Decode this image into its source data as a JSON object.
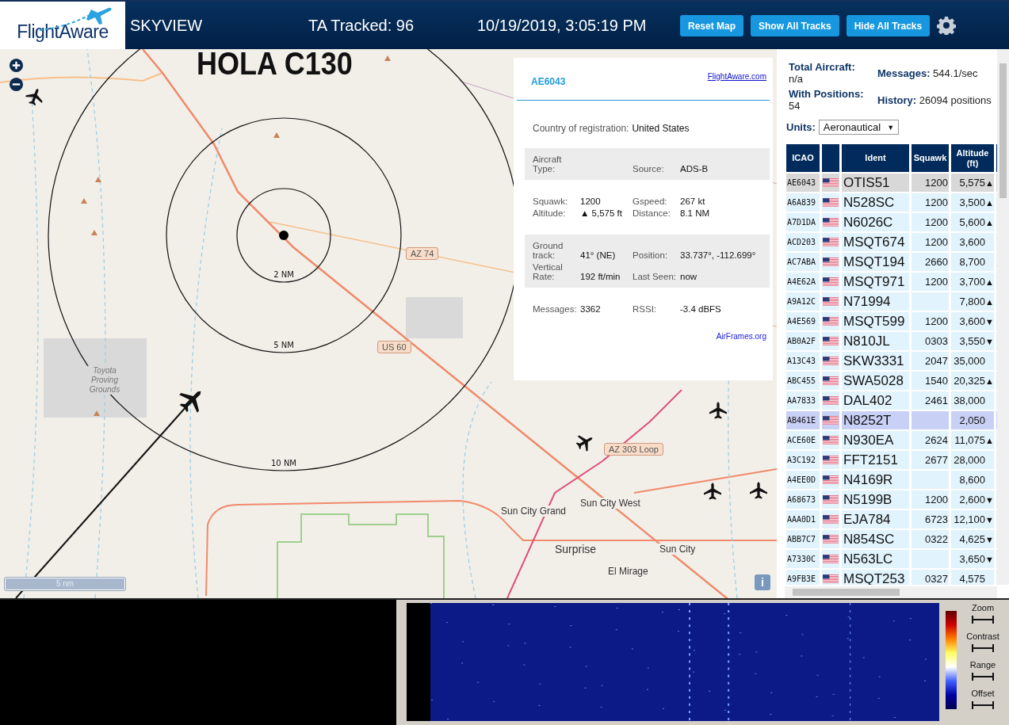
{
  "header": {
    "logo": "FlightAware",
    "title": "SKYVIEW",
    "tracked": "TA Tracked: 96",
    "datetime": "10/19/2019, 3:05:19 PM",
    "buttons": [
      "Reset Map",
      "Show All Tracks",
      "Hide All Tracks"
    ]
  },
  "map": {
    "annotation": "HOLA C130",
    "rings": [
      "2 NM",
      "5 NM",
      "10 NM"
    ],
    "scale": "5 nm",
    "info_button": "i",
    "labels": [
      {
        "text": "AZ 74",
        "kind": "shield"
      },
      {
        "text": "US 60",
        "kind": "shield"
      },
      {
        "text": "AZ 303 Loop",
        "kind": "shield"
      },
      {
        "text": "Toyota Proving Grounds",
        "kind": "area"
      },
      {
        "text": "Sun City Grand",
        "kind": "town"
      },
      {
        "text": "Sun City West",
        "kind": "town"
      },
      {
        "text": "Surprise",
        "kind": "city"
      },
      {
        "text": "Sun City",
        "kind": "town"
      },
      {
        "text": "El Mirage",
        "kind": "town"
      }
    ]
  },
  "popup": {
    "icao": "AE6043",
    "link": "FlightAware.com",
    "sections": [
      {
        "kind": "wide",
        "items": [
          {
            "label": "Country of registration:",
            "value": "United States"
          }
        ]
      },
      {
        "kind": "band",
        "items": [
          {
            "label": "Aircraft Type:",
            "value": ""
          },
          {
            "label": "Source:",
            "value": "ADS-B"
          }
        ]
      },
      {
        "kind": "grid",
        "items": [
          {
            "label": "Squawk:",
            "value": "1200"
          },
          {
            "label": "Gspeed:",
            "value": "267 kt"
          },
          {
            "label": "Altitude:",
            "value": "▲ 5,575 ft"
          },
          {
            "label": "Distance:",
            "value": "8.1 NM"
          }
        ]
      },
      {
        "kind": "band",
        "items": [
          {
            "label": "Ground track:",
            "value": "41° (NE)"
          },
          {
            "label": "Position:",
            "value": "33.737°, -112.699°"
          },
          {
            "label": "Vertical Rate:",
            "value": "192 ft/min"
          },
          {
            "label": "Last Seen:",
            "value": "now"
          }
        ]
      },
      {
        "kind": "grid",
        "items": [
          {
            "label": "Messages:",
            "value": "3362"
          },
          {
            "label": "RSSI:",
            "value": "-3.4 dBFS"
          }
        ]
      }
    ],
    "footer_link": "AirFrames.org"
  },
  "stats": [
    {
      "label": "Total Aircraft:",
      "value": "n/a"
    },
    {
      "label": "Messages:",
      "value": "544.1/sec"
    },
    {
      "label": "With Positions:",
      "value": "54"
    },
    {
      "label": "History:",
      "value": "26094 positions"
    }
  ],
  "units": {
    "label": "Units:",
    "value": "Aeronautical",
    "caret": "▼"
  },
  "table": {
    "columns": [
      "ICAO",
      "",
      "Ident",
      "Squawk",
      "Altitude (ft)"
    ],
    "rows": [
      {
        "icao": "AE6043",
        "ident": "OTIS51",
        "squawk": "1200",
        "altitude": "5,575",
        "trend": "▲",
        "selected": true,
        "highlighted": false
      },
      {
        "icao": "A6A839",
        "ident": "N528SC",
        "squawk": "1200",
        "altitude": "3,500",
        "trend": "▲",
        "selected": false,
        "highlighted": false
      },
      {
        "icao": "A7D1DA",
        "ident": "N6026C",
        "squawk": "1200",
        "altitude": "5,600",
        "trend": "▲",
        "selected": false,
        "highlighted": false
      },
      {
        "icao": "ACD203",
        "ident": "MSQT674",
        "squawk": "1200",
        "altitude": "3,600",
        "trend": "",
        "selected": false,
        "highlighted": false
      },
      {
        "icao": "AC7ABA",
        "ident": "MSQT194",
        "squawk": "2660",
        "altitude": "8,700",
        "trend": "",
        "selected": false,
        "highlighted": false
      },
      {
        "icao": "A4E62A",
        "ident": "MSQT971",
        "squawk": "1200",
        "altitude": "3,700",
        "trend": "▲",
        "selected": false,
        "highlighted": false
      },
      {
        "icao": "A9A12C",
        "ident": "N71994",
        "squawk": "",
        "altitude": "7,800",
        "trend": "▲",
        "selected": false,
        "highlighted": false
      },
      {
        "icao": "A4E569",
        "ident": "MSQT599",
        "squawk": "1200",
        "altitude": "3,600",
        "trend": "▼",
        "selected": false,
        "highlighted": false
      },
      {
        "icao": "AB0A2F",
        "ident": "N810JL",
        "squawk": "0303",
        "altitude": "3,550",
        "trend": "▼",
        "selected": false,
        "highlighted": false
      },
      {
        "icao": "A13C43",
        "ident": "SKW3331",
        "squawk": "2047",
        "altitude": "35,000",
        "trend": "",
        "selected": false,
        "highlighted": false
      },
      {
        "icao": "ABC455",
        "ident": "SWA5028",
        "squawk": "1540",
        "altitude": "20,325",
        "trend": "▲",
        "selected": false,
        "highlighted": false
      },
      {
        "icao": "AA7833",
        "ident": "DAL402",
        "squawk": "2461",
        "altitude": "38,000",
        "trend": "",
        "selected": false,
        "highlighted": false
      },
      {
        "icao": "AB461E",
        "ident": "N8252T",
        "squawk": "",
        "altitude": "2,050",
        "trend": "",
        "selected": false,
        "highlighted": true
      },
      {
        "icao": "ACE60E",
        "ident": "N930EA",
        "squawk": "2624",
        "altitude": "11,075",
        "trend": "▲",
        "selected": false,
        "highlighted": false
      },
      {
        "icao": "A3C192",
        "ident": "FFT2151",
        "squawk": "2677",
        "altitude": "28,000",
        "trend": "",
        "selected": false,
        "highlighted": false
      },
      {
        "icao": "A4EE0D",
        "ident": "N4169R",
        "squawk": "",
        "altitude": "8,600",
        "trend": "",
        "selected": false,
        "highlighted": false
      },
      {
        "icao": "A68673",
        "ident": "N5199B",
        "squawk": "1200",
        "altitude": "2,600",
        "trend": "▼",
        "selected": false,
        "highlighted": false
      },
      {
        "icao": "AAA0D1",
        "ident": "EJA784",
        "squawk": "6723",
        "altitude": "12,100",
        "trend": "▼",
        "selected": false,
        "highlighted": false
      },
      {
        "icao": "ABB7C7",
        "ident": "N854SC",
        "squawk": "0322",
        "altitude": "4,625",
        "trend": "▼",
        "selected": false,
        "highlighted": false
      },
      {
        "icao": "A7330C",
        "ident": "N563LC",
        "squawk": "",
        "altitude": "3,650",
        "trend": "▼",
        "selected": false,
        "highlighted": false
      },
      {
        "icao": "A9FB3E",
        "ident": "MSQT253",
        "squawk": "0327",
        "altitude": "4,575",
        "trend": "",
        "selected": false,
        "highlighted": false
      }
    ]
  },
  "spectrum": {
    "controls": [
      "Zoom",
      "Contrast",
      "Range",
      "Offset"
    ]
  }
}
